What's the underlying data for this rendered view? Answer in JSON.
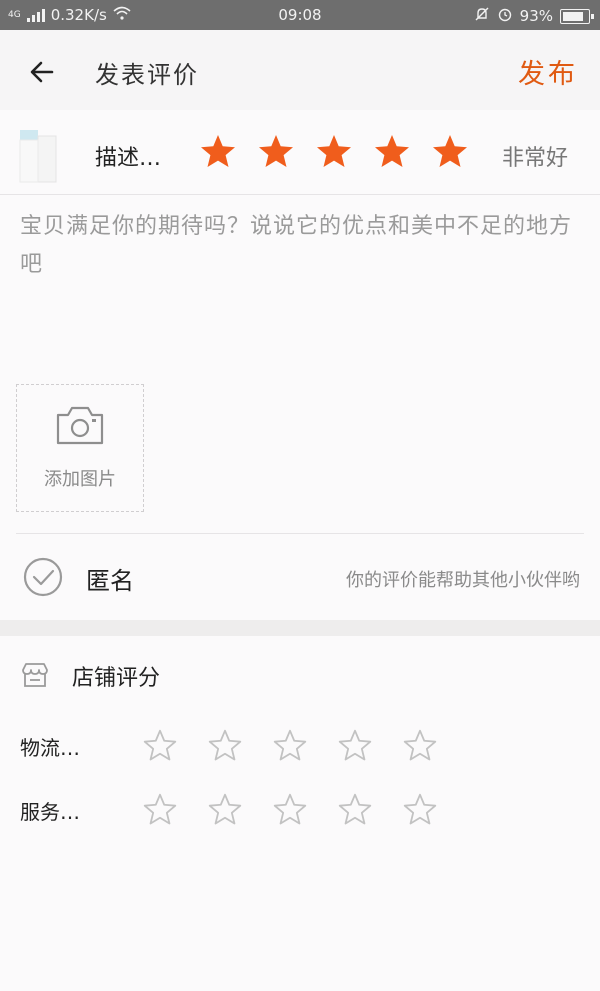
{
  "status_bar": {
    "network": "4G",
    "speed": "0.32K/s",
    "time": "09:08",
    "battery_percent": "93%"
  },
  "header": {
    "title": "发表评价",
    "publish_label": "发布"
  },
  "product": {
    "label": "描述…",
    "rating": 5,
    "rating_text": "非常好"
  },
  "review": {
    "placeholder": "宝贝满足你的期待吗？说说它的优点和美中不足的地方吧"
  },
  "photo": {
    "add_label": "添加图片"
  },
  "anonymous": {
    "label": "匿名",
    "hint": "你的评价能帮助其他小伙伴哟"
  },
  "shop_rating": {
    "title": "店铺评分",
    "items": [
      {
        "label": "物流…",
        "rating": 0
      },
      {
        "label": "服务…",
        "rating": 0
      }
    ]
  },
  "colors": {
    "accent": "#e05a12",
    "star_filled": "#f05d1c",
    "star_empty": "#c2c2c2"
  }
}
